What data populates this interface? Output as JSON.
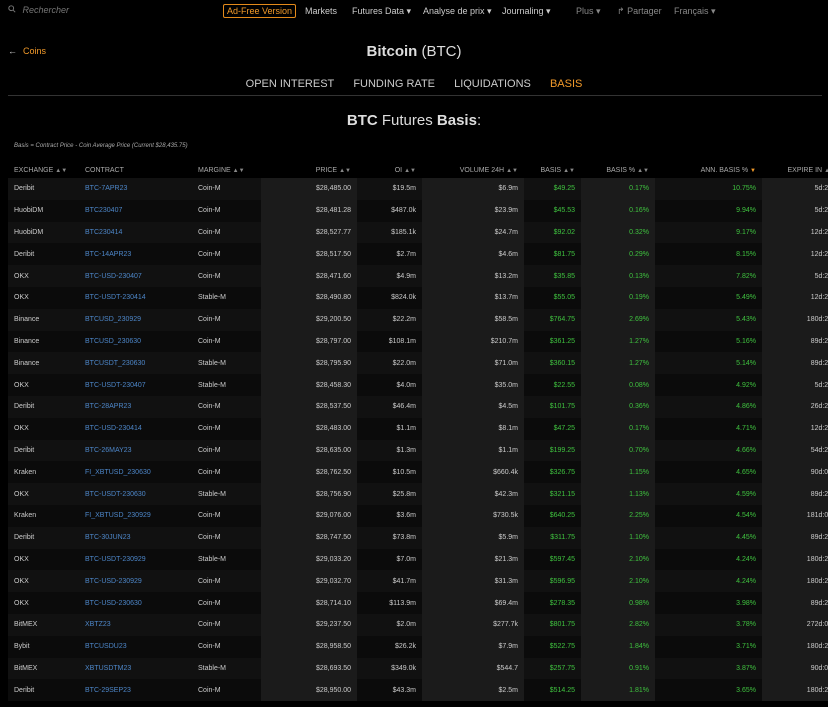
{
  "topbar": {
    "search_placeholder": "Rechercher",
    "ad_free": "Ad-Free Version",
    "nav": [
      "Markets",
      "Futures Data ▾",
      "Analyse de prix ▾",
      "Journaling ▾"
    ],
    "plus": "Plus ▾",
    "share": "Partager",
    "language": "Français ▾"
  },
  "back_label": "Coins",
  "page_title": {
    "name": "Bitcoin",
    "symbol": "(BTC)"
  },
  "tabs": [
    "OPEN INTEREST",
    "FUNDING RATE",
    "LIQUIDATIONS",
    "BASIS"
  ],
  "active_tab": "BASIS",
  "section_title": {
    "bold1": "BTC",
    "middle": " Futures ",
    "bold2": "Basis",
    "end": ":"
  },
  "formula": "Basis = Contract Price - Coin Average Price (Current $28,435.75)",
  "table": {
    "columns": [
      "EXCHANGE",
      "CONTRACT",
      "MARGINE",
      "PRICE",
      "OI",
      "VOLUME 24H",
      "BASIS",
      "BASIS %",
      "ANN. BASIS %",
      "EXPIRE IN"
    ],
    "rows": [
      [
        "Deribit",
        "BTC-7APR23",
        "Coin-M",
        "$28,485.00",
        "$19.5m",
        "$6.9m",
        "$49.25",
        "0.17%",
        "10.75%",
        "5d:21h"
      ],
      [
        "HuobiDM",
        "BTC230407",
        "Coin-M",
        "$28,481.28",
        "$487.0k",
        "$23.9m",
        "$45.53",
        "0.16%",
        "9.94%",
        "5d:21h"
      ],
      [
        "HuobiDM",
        "BTC230414",
        "Coin-M",
        "$28,527.77",
        "$185.1k",
        "$24.7m",
        "$92.02",
        "0.32%",
        "9.17%",
        "12d:21h"
      ],
      [
        "Deribit",
        "BTC-14APR23",
        "Coin-M",
        "$28,517.50",
        "$2.7m",
        "$4.6m",
        "$81.75",
        "0.29%",
        "8.15%",
        "12d:21h"
      ],
      [
        "OKX",
        "BTC-USD-230407",
        "Coin-M",
        "$28,471.60",
        "$4.9m",
        "$13.2m",
        "$35.85",
        "0.13%",
        "7.82%",
        "5d:21h"
      ],
      [
        "OKX",
        "BTC-USDT-230414",
        "Stable-M",
        "$28,490.80",
        "$824.0k",
        "$13.7m",
        "$55.05",
        "0.19%",
        "5.49%",
        "12d:21h"
      ],
      [
        "Binance",
        "BTCUSD_230929",
        "Coin-M",
        "$29,200.50",
        "$22.2m",
        "$58.5m",
        "$764.75",
        "2.69%",
        "5.43%",
        "180d:21h"
      ],
      [
        "Binance",
        "BTCUSD_230630",
        "Coin-M",
        "$28,797.00",
        "$108.1m",
        "$210.7m",
        "$361.25",
        "1.27%",
        "5.16%",
        "89d:21h"
      ],
      [
        "Binance",
        "BTCUSDT_230630",
        "Stable-M",
        "$28,795.90",
        "$22.0m",
        "$71.0m",
        "$360.15",
        "1.27%",
        "5.14%",
        "89d:21h"
      ],
      [
        "OKX",
        "BTC-USDT-230407",
        "Stable-M",
        "$28,458.30",
        "$4.0m",
        "$35.0m",
        "$22.55",
        "0.08%",
        "4.92%",
        "5d:21h"
      ],
      [
        "Deribit",
        "BTC-28APR23",
        "Coin-M",
        "$28,537.50",
        "$46.4m",
        "$4.5m",
        "$101.75",
        "0.36%",
        "4.86%",
        "26d:21h"
      ],
      [
        "OKX",
        "BTC-USD-230414",
        "Coin-M",
        "$28,483.00",
        "$1.1m",
        "$8.1m",
        "$47.25",
        "0.17%",
        "4.71%",
        "12d:21h"
      ],
      [
        "Deribit",
        "BTC-26MAY23",
        "Coin-M",
        "$28,635.00",
        "$1.3m",
        "$1.1m",
        "$199.25",
        "0.70%",
        "4.66%",
        "54d:21h"
      ],
      [
        "Kraken",
        "FI_XBTUSD_230630",
        "Coin-M",
        "$28,762.50",
        "$10.5m",
        "$660.4k",
        "$326.75",
        "1.15%",
        "4.65%",
        "90d:04h"
      ],
      [
        "OKX",
        "BTC-USDT-230630",
        "Stable-M",
        "$28,756.90",
        "$25.8m",
        "$42.3m",
        "$321.15",
        "1.13%",
        "4.59%",
        "89d:21h"
      ],
      [
        "Kraken",
        "FI_XBTUSD_230929",
        "Coin-M",
        "$29,076.00",
        "$3.6m",
        "$730.5k",
        "$640.25",
        "2.25%",
        "4.54%",
        "181d:04h"
      ],
      [
        "Deribit",
        "BTC-30JUN23",
        "Coin-M",
        "$28,747.50",
        "$73.8m",
        "$5.9m",
        "$311.75",
        "1.10%",
        "4.45%",
        "89d:21h"
      ],
      [
        "OKX",
        "BTC-USDT-230929",
        "Stable-M",
        "$29,033.20",
        "$7.0m",
        "$21.3m",
        "$597.45",
        "2.10%",
        "4.24%",
        "180d:21h"
      ],
      [
        "OKX",
        "BTC-USD-230929",
        "Coin-M",
        "$29,032.70",
        "$41.7m",
        "$31.3m",
        "$596.95",
        "2.10%",
        "4.24%",
        "180d:21h"
      ],
      [
        "OKX",
        "BTC-USD-230630",
        "Coin-M",
        "$28,714.10",
        "$113.9m",
        "$69.4m",
        "$278.35",
        "0.98%",
        "3.98%",
        "89d:21h"
      ],
      [
        "BitMEX",
        "XBTZ23",
        "Coin-M",
        "$29,237.50",
        "$2.0m",
        "$277.7k",
        "$801.75",
        "2.82%",
        "3.78%",
        "272d:01h"
      ],
      [
        "Bybit",
        "BTCUSDU23",
        "Coin-M",
        "$28,958.50",
        "$26.2k",
        "$7.9m",
        "$522.75",
        "1.84%",
        "3.71%",
        "180d:21h"
      ],
      [
        "BitMEX",
        "XBTUSDTM23",
        "Stable-M",
        "$28,693.50",
        "$349.0k",
        "$544.7",
        "$257.75",
        "0.91%",
        "3.87%",
        "90d:01h"
      ],
      [
        "Deribit",
        "BTC-29SEP23",
        "Coin-M",
        "$28,950.00",
        "$43.3m",
        "$2.5m",
        "$514.25",
        "1.81%",
        "3.65%",
        "180d:21h"
      ]
    ]
  },
  "colors": {
    "accent": "#f29a2a",
    "positive": "#3fc23f",
    "link": "#4d86c8"
  }
}
